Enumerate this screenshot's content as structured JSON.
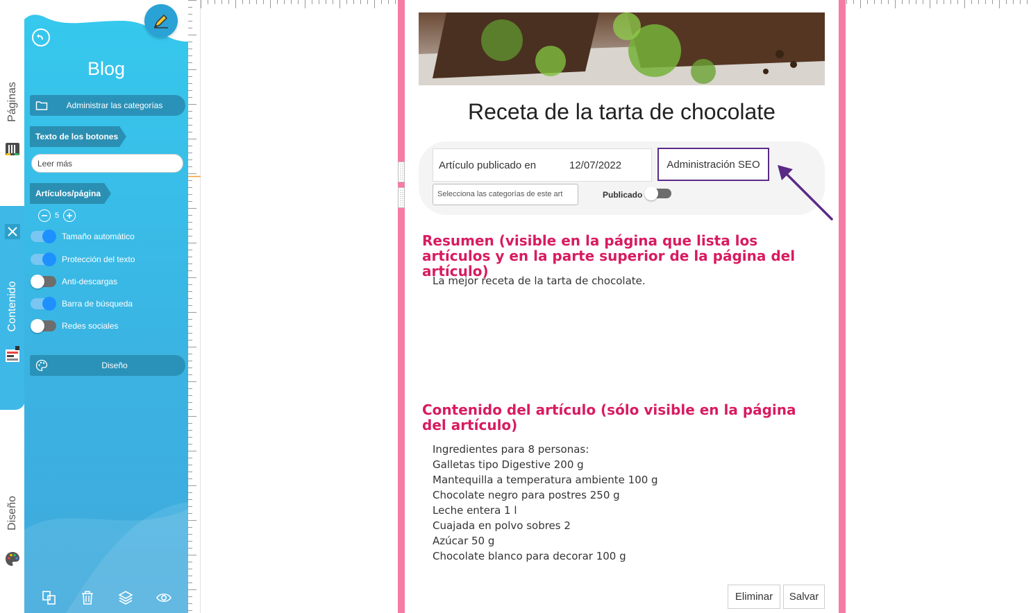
{
  "vertical_tabs": {
    "pages_label": "Páginas",
    "content_label": "Contenido",
    "design_label": "Diseño",
    "pages_icon": "pages-icon",
    "close_icon": "close-icon",
    "content_icon": "content-blocks-icon",
    "palette_icon": "palette-icon"
  },
  "panel": {
    "title": "Blog",
    "manage_categories_label": "Administrar las categorías",
    "buttons_text_header": "Texto de los botones",
    "read_more_value": "Leer más",
    "articles_per_page_header": "Artículos/página",
    "articles_per_page_value": "5",
    "toggles": [
      {
        "label": "Tamaño automático",
        "on": true
      },
      {
        "label": "Protección del texto",
        "on": true
      },
      {
        "label": "Anti-descargas",
        "on": false
      },
      {
        "label": "Barra de búsqueda",
        "on": true
      },
      {
        "label": "Redes sociales",
        "on": false
      }
    ],
    "design_button_label": "Diseño",
    "bottom_icons": [
      "duplicate-icon",
      "trash-icon",
      "layers-icon",
      "eye-icon"
    ]
  },
  "article": {
    "title": "Receta de la tarta de chocolate",
    "published_label": "Artículo publicado en",
    "published_date": "12/07/2022",
    "seo_label": "Administración SEO",
    "category_placeholder": "Selecciona las categorías de este art",
    "published_toggle_label": "Publicado",
    "published_on": false,
    "summary_heading": "Resumen (visible en la página que lista los artículos y en la parte superior de la página del artículo)",
    "summary_text": "La mejor receta de la tarta de chocolate.",
    "content_heading": "Contenido del artículo (sólo visible en la página del artículo)",
    "ingredients": [
      "Ingredientes para 8 personas:",
      "Galletas tipo Digestive 200 g",
      "Mantequilla a temperatura ambiente 100 g",
      "Chocolate negro para postres 250 g",
      "Leche entera 1 l",
      "Cuajada en polvo sobres 2",
      "Azúcar 50 g",
      "Chocolate blanco para decorar 100 g"
    ],
    "delete_label": "Eliminar",
    "save_label": "Salvar"
  },
  "colors": {
    "panel_accent": "#36c9ee",
    "section_heading": "#d81b60",
    "canvas_border": "#f47ca5",
    "seo_highlight": "#5a2a86"
  }
}
